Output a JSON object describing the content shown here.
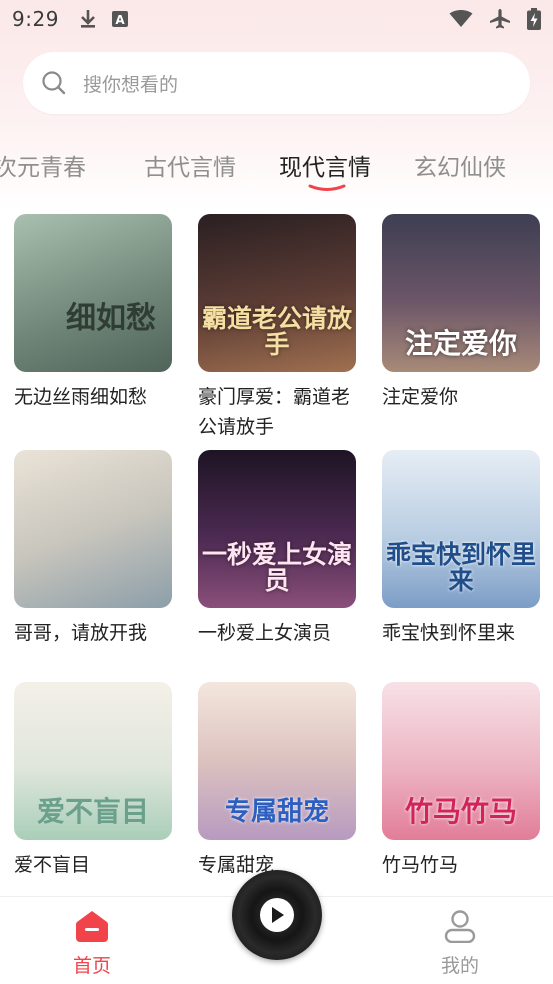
{
  "status_bar": {
    "time": "9:29"
  },
  "search": {
    "placeholder": "搜你想看的"
  },
  "tabs": [
    {
      "label": "次元青春"
    },
    {
      "label": "古代言情"
    },
    {
      "label": "现代言情"
    },
    {
      "label": "玄幻仙侠"
    }
  ],
  "active_tab": "现代言情",
  "books": [
    {
      "title": "无边丝雨细如愁",
      "cover_text": "细如愁",
      "cover_colors": [
        "#9fb5a5",
        "#5f7466"
      ]
    },
    {
      "title": "豪门厚爱：霸道老公请放手",
      "cover_text": "霸道老公请放手",
      "cover_colors": [
        "#3b2a2c",
        "#8a5a4a"
      ]
    },
    {
      "title": "注定爱你",
      "cover_text": "注定爱你",
      "cover_colors": [
        "#4a4a5a",
        "#8b6a78"
      ]
    },
    {
      "title": "哥哥，请放开我",
      "cover_text": "",
      "cover_colors": [
        "#e3dcd3",
        "#9aa7b0"
      ]
    },
    {
      "title": "一秒爱上女演员",
      "cover_text": "一秒爱上女演员",
      "cover_colors": [
        "#2a1a30",
        "#6a3a6a"
      ]
    },
    {
      "title": "乖宝快到怀里来",
      "cover_text": "乖宝快到怀里来",
      "cover_colors": [
        "#dfe8f2",
        "#8fb0d5"
      ]
    },
    {
      "title": "爱不盲目",
      "cover_text": "爱不盲目",
      "cover_colors": [
        "#f1ece4",
        "#b9d6c0"
      ]
    },
    {
      "title": "专属甜宠",
      "cover_text": "专属甜宠",
      "cover_colors": [
        "#f3e2dc",
        "#c7a6c4"
      ]
    },
    {
      "title": "竹马竹马",
      "cover_text": "竹马竹马",
      "cover_colors": [
        "#f6dce2",
        "#e58aa0"
      ]
    }
  ],
  "bottom_nav": {
    "home_label": "首页",
    "mine_label": "我的"
  },
  "colors": {
    "accent": "#f0434a",
    "tab_active": "#222222",
    "tab_inactive": "#8f8f8f"
  }
}
